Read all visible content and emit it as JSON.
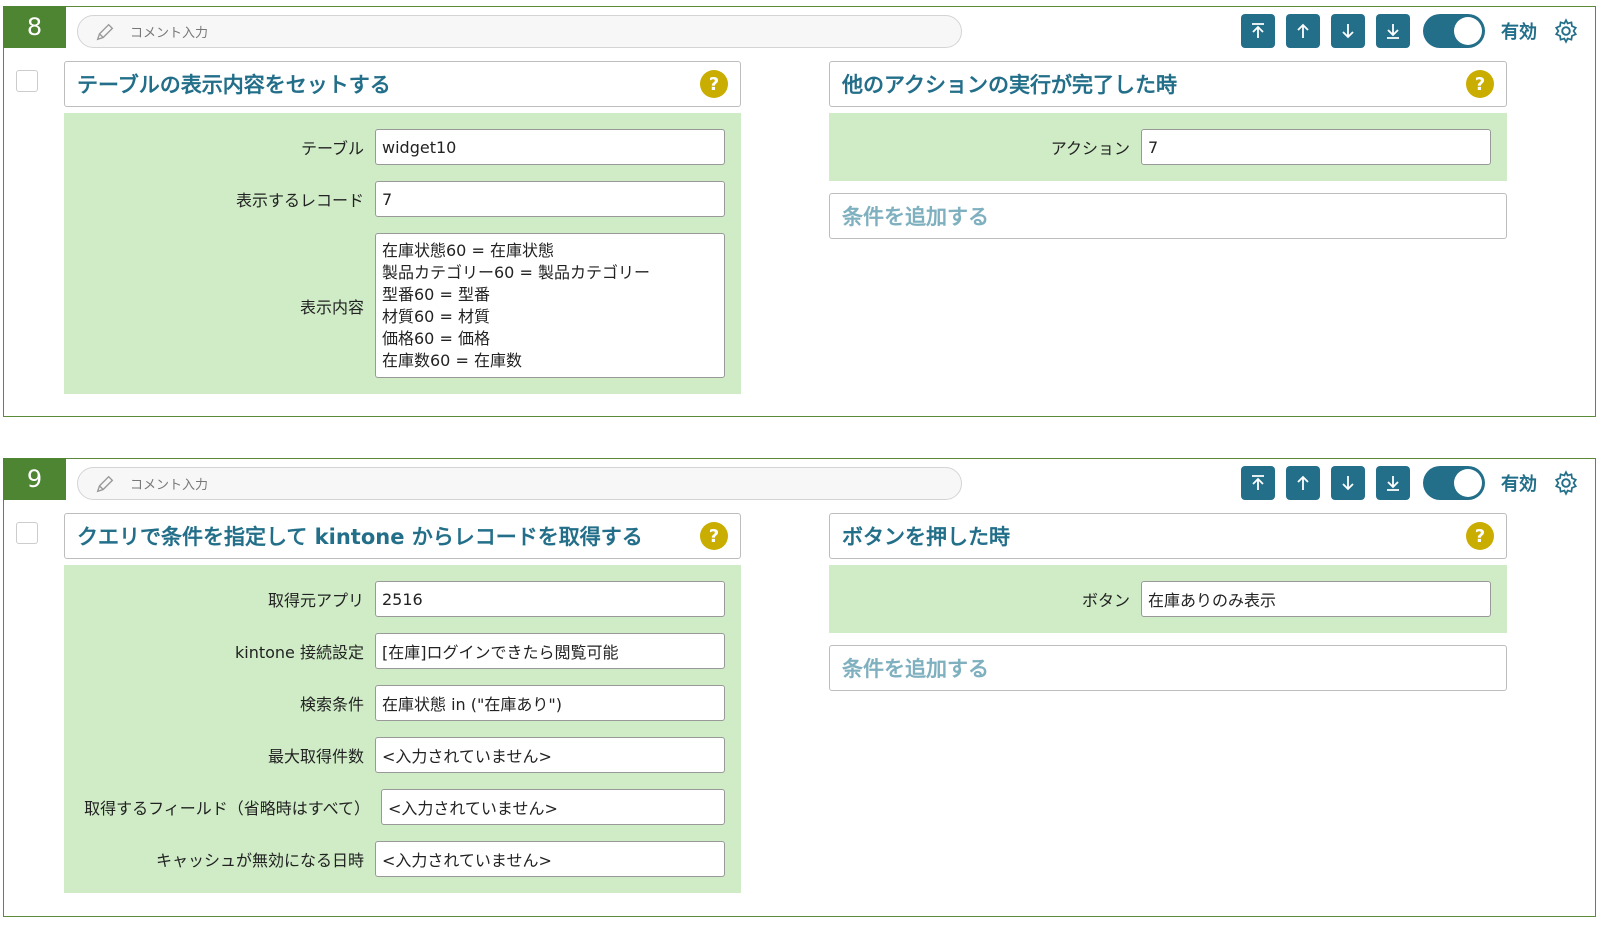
{
  "blocks": [
    {
      "number": "8",
      "comment_placeholder": "コメント入力",
      "enabled_label": "有効",
      "action": {
        "title": "テーブルの表示内容をセットする",
        "fields": [
          {
            "label": "テーブル",
            "value": "widget10"
          },
          {
            "label": "表示するレコード",
            "value": "7"
          },
          {
            "label": "表示内容",
            "lines": [
              "在庫状態60 = 在庫状態",
              "製品カテゴリー60 = 製品カテゴリー",
              "型番60 = 型番",
              "材質60 = 材質",
              "価格60 = 価格",
              "在庫数60 = 在庫数"
            ]
          }
        ]
      },
      "trigger": {
        "title": "他のアクションの実行が完了した時",
        "fields": [
          {
            "label": "アクション",
            "value": "7"
          }
        ],
        "add_condition": "条件を追加する"
      }
    },
    {
      "number": "9",
      "comment_placeholder": "コメント入力",
      "enabled_label": "有効",
      "action": {
        "title": "クエリで条件を指定して kintone からレコードを取得する",
        "fields": [
          {
            "label": "取得元アプリ",
            "value": "2516"
          },
          {
            "label": "kintone 接続設定",
            "value": "[在庫]ログインできたら閲覧可能"
          },
          {
            "label": "検索条件",
            "value": "在庫状態 in (\"在庫あり\")"
          },
          {
            "label": "最大取得件数",
            "value": "<入力されていません>"
          },
          {
            "label": "取得するフィールド（省略時はすべて）",
            "value": "<入力されていません>"
          },
          {
            "label": "キャッシュが無効になる日時",
            "value": "<入力されていません>"
          }
        ]
      },
      "trigger": {
        "title": "ボタンを押した時",
        "fields": [
          {
            "label": "ボタン",
            "value": "在庫ありのみ表示"
          }
        ],
        "add_condition": "条件を追加する"
      }
    }
  ],
  "help_glyph": "?",
  "colors": {
    "block_border": "#5a8a3a",
    "number_bg": "#4d8533",
    "accent": "#236f8a",
    "panel_bg": "#cfecc6",
    "help": "#c9ad00"
  },
  "icons": [
    "pencil-icon",
    "move-top-icon",
    "move-up-icon",
    "move-down-icon",
    "move-bottom-icon",
    "gear-icon",
    "help-icon"
  ]
}
